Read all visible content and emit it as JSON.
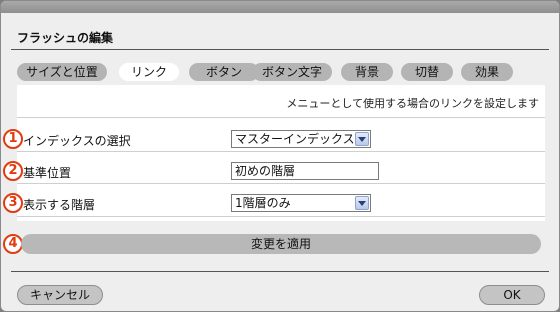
{
  "dialog": {
    "title": "フラッシュの編集"
  },
  "tabs": [
    {
      "label": "サイズと位置",
      "active": false
    },
    {
      "label": "リンク",
      "active": true
    },
    {
      "label": "ボタン",
      "active": false
    },
    {
      "label": "ボタン文字",
      "active": false
    },
    {
      "label": "背景",
      "active": false
    },
    {
      "label": "切替",
      "active": false
    },
    {
      "label": "効果",
      "active": false
    }
  ],
  "panel": {
    "description": "メニューとして使用する場合のリンクを設定します",
    "rows": [
      {
        "number": "1",
        "label": "インデックスの選択",
        "control": "select",
        "value": "マスターインデックス"
      },
      {
        "number": "2",
        "label": "基準位置",
        "control": "text",
        "value": "初めの階層"
      },
      {
        "number": "3",
        "label": "表示する階層",
        "control": "select",
        "value": "1階層のみ"
      }
    ]
  },
  "apply": {
    "number": "4",
    "label": "変更を適用"
  },
  "footer": {
    "cancel_label": "キャンセル",
    "ok_label": "OK"
  },
  "colors": {
    "accent": "#e23b10",
    "tab_inactive": "#b4b4b4",
    "tab_active": "#ffffff"
  }
}
